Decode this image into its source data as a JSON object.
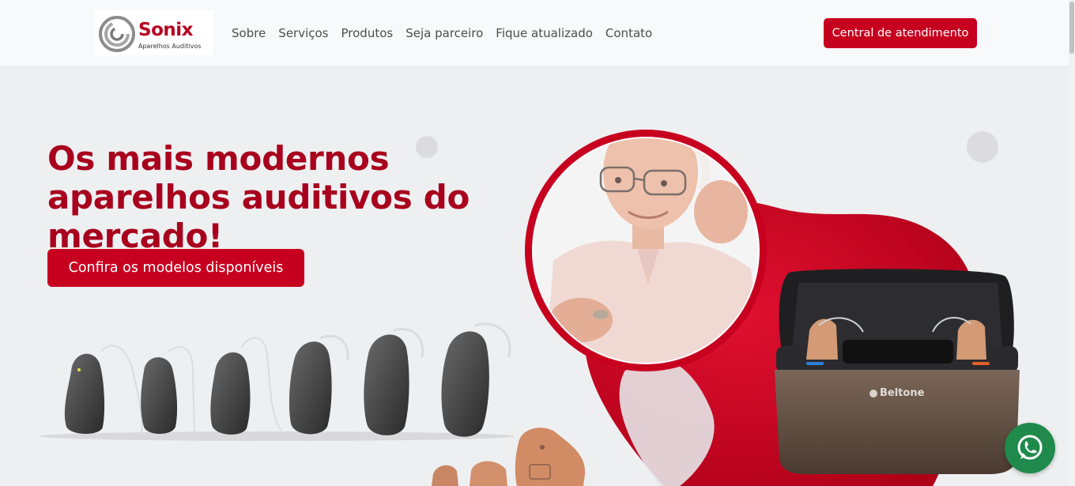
{
  "brand": {
    "name": "Sonix",
    "tagline": "Aparelhos Auditivos",
    "color": "#b8001f"
  },
  "nav": {
    "links": [
      "Sobre",
      "Serviços",
      "Produtos",
      "Seja parceiro",
      "Fique atualizado",
      "Contato"
    ],
    "cta_label": "Central de atendimento"
  },
  "hero": {
    "headline_line1": "Os mais modernos",
    "headline_line2": "aparelhos auditivos do",
    "headline_line3": "mercado!",
    "cta_label": "Confira os modelos disponíveis",
    "case_brand": "Beltone"
  },
  "colors": {
    "accent": "#c8001f",
    "headline": "#a8001d",
    "background": "#eeeff1",
    "whatsapp": "#1f8a4c"
  },
  "icons": {
    "whatsapp": "whatsapp-icon",
    "logo": "sonix-swirl-icon"
  }
}
